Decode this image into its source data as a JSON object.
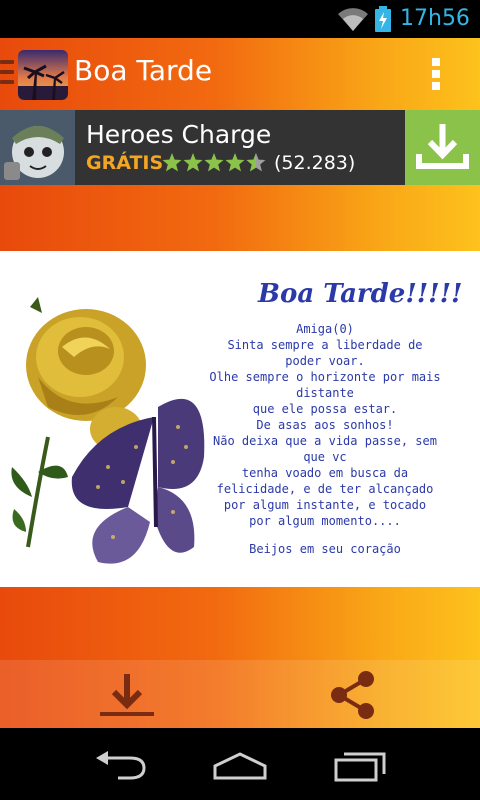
{
  "status_bar": {
    "time": "17h56"
  },
  "action_bar": {
    "title": "Boa Tarde"
  },
  "ad": {
    "title": "Heroes Charge",
    "price_label": "GRÁTIS",
    "rating": 4.5,
    "reviews": "(52.283)"
  },
  "card": {
    "title": "Boa Tarde!!!!!",
    "lines": [
      "Amiga(0)",
      "Sinta sempre a liberdade de poder voar.",
      "Olhe sempre o horizonte por mais distante",
      "que ele possa estar.",
      "De asas  aos sonhos!",
      "Não deixa que a vida passe, sem que vc",
      "tenha voado em busca da felicidade, e de ter alcançado",
      "por algum instante, e tocado",
      "por algum momento....",
      "Beijos em seu coração"
    ]
  },
  "icons": {
    "wifi": "wifi-icon",
    "battery": "battery-charging-icon",
    "drawer": "drawer-icon",
    "overflow": "overflow-menu-icon",
    "ad_download": "download-icon",
    "toolbar_download": "download-icon",
    "toolbar_share": "share-icon",
    "nav_back": "back-icon",
    "nav_home": "home-icon",
    "nav_recents": "recents-icon"
  },
  "colors": {
    "status_time": "#33b5e5",
    "gradient_start": "#e84a0c",
    "gradient_end": "#fdc21c",
    "ad_background": "#333333",
    "ad_price": "#f4a623",
    "ad_button": "#8bc34a",
    "card_text": "#2b3aa8"
  }
}
